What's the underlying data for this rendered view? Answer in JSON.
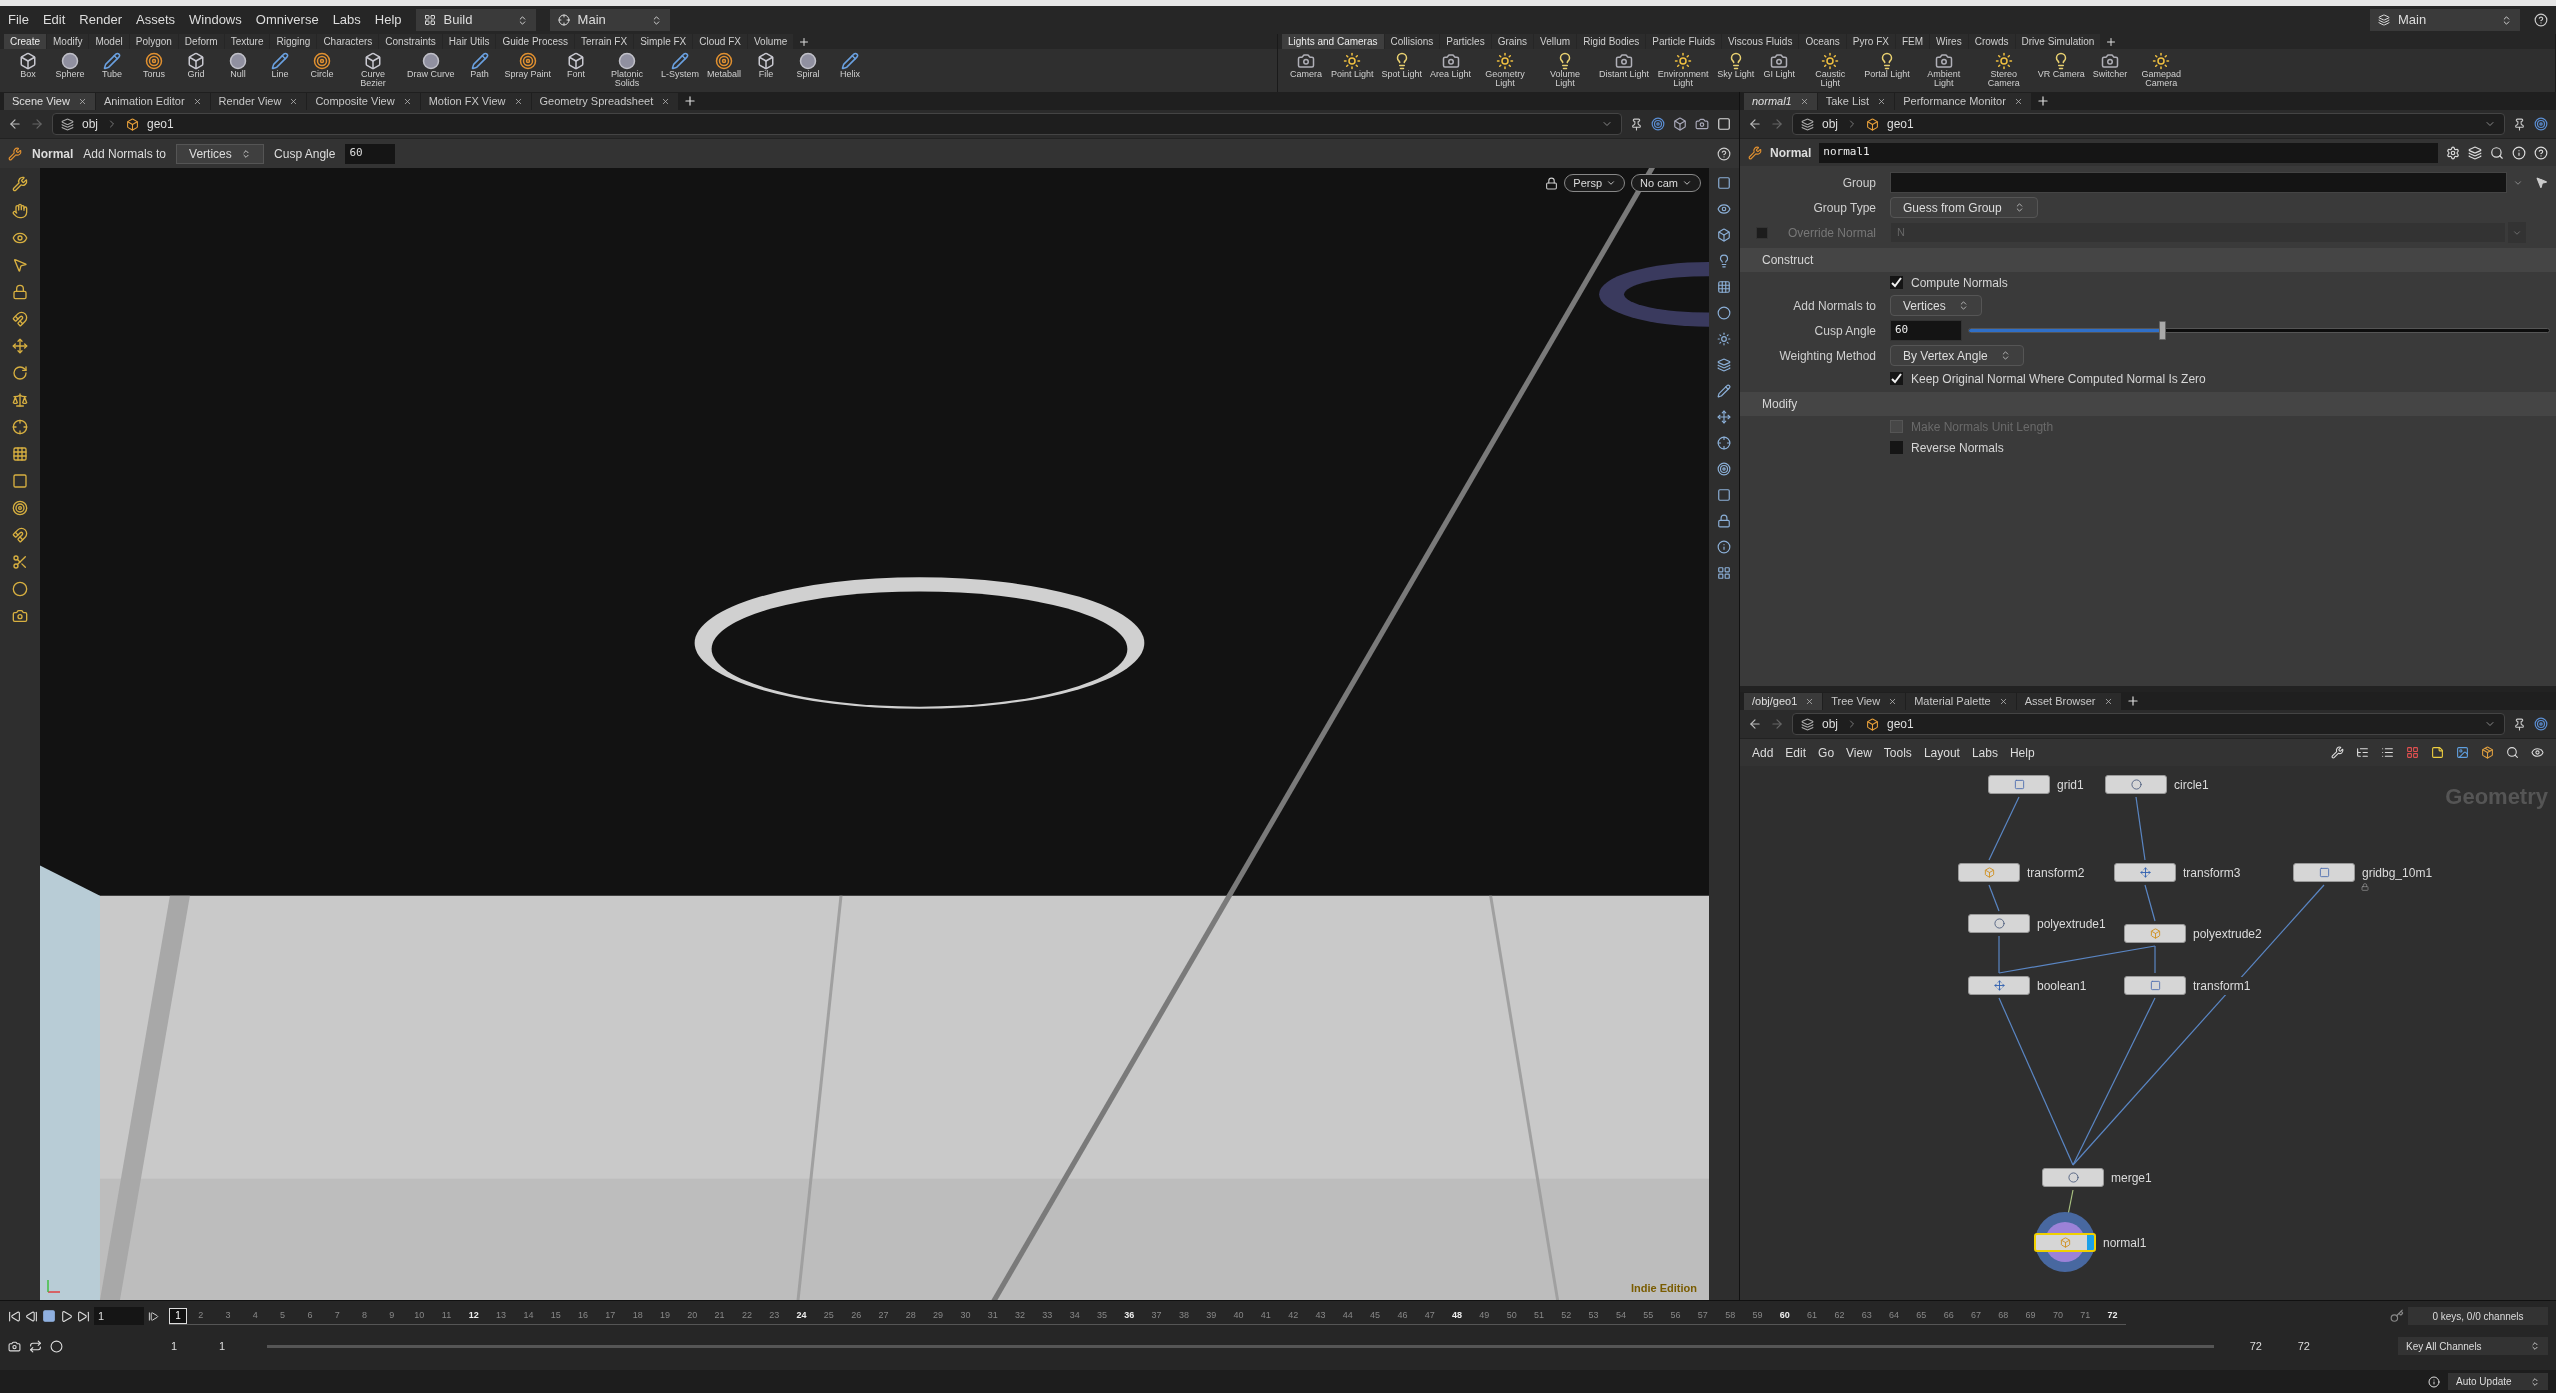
{
  "menu_bar": {
    "items": [
      "File",
      "Edit",
      "Render",
      "Assets",
      "Windows",
      "Omniverse",
      "Labs",
      "Help"
    ],
    "desktop": "Build",
    "workspace": "Main",
    "right_workspace": "Main"
  },
  "shelf_left": {
    "tabs": [
      {
        "label": "Create",
        "selected": true
      },
      {
        "label": "Modify",
        "selected": false
      },
      {
        "label": "Model",
        "selected": false
      },
      {
        "label": "Polygon",
        "selected": false
      },
      {
        "label": "Deform",
        "selected": false
      },
      {
        "label": "Texture",
        "selected": false
      },
      {
        "label": "Rigging",
        "selected": false
      },
      {
        "label": "Characters",
        "selected": false
      },
      {
        "label": "Constraints",
        "selected": false
      },
      {
        "label": "Hair Utils",
        "selected": false
      },
      {
        "label": "Guide Process",
        "selected": false
      },
      {
        "label": "Terrain FX",
        "selected": false
      },
      {
        "label": "Simple FX",
        "selected": false
      },
      {
        "label": "Cloud FX",
        "selected": false
      },
      {
        "label": "Volume",
        "selected": false
      }
    ],
    "tools": [
      "Box",
      "Sphere",
      "Tube",
      "Torus",
      "Grid",
      "Null",
      "Line",
      "Circle",
      "Curve Bezier",
      "Draw Curve",
      "Path",
      "Spray Paint",
      "Font",
      "Platonic Solids",
      "L-System",
      "Metaball",
      "File",
      "Spiral",
      "Helix"
    ]
  },
  "shelf_right": {
    "tabs": [
      {
        "label": "Lights and Cameras",
        "selected": true
      },
      {
        "label": "Collisions",
        "selected": false
      },
      {
        "label": "Particles",
        "selected": false
      },
      {
        "label": "Grains",
        "selected": false
      },
      {
        "label": "Vellum",
        "selected": false
      },
      {
        "label": "Rigid Bodies",
        "selected": false
      },
      {
        "label": "Particle Fluids",
        "selected": false
      },
      {
        "label": "Viscous Fluids",
        "selected": false
      },
      {
        "label": "Oceans",
        "selected": false
      },
      {
        "label": "Pyro FX",
        "selected": false
      },
      {
        "label": "FEM",
        "selected": false
      },
      {
        "label": "Wires",
        "selected": false
      },
      {
        "label": "Crowds",
        "selected": false
      },
      {
        "label": "Drive Simulation",
        "selected": false
      }
    ],
    "tools": [
      "Camera",
      "Point Light",
      "Spot Light",
      "Area Light",
      "Geometry Light",
      "Volume Light",
      "Distant Light",
      "Environment Light",
      "Sky Light",
      "GI Light",
      "Caustic Light",
      "Portal Light",
      "Ambient Light",
      "Stereo Camera",
      "VR Camera",
      "Switcher",
      "Gamepad Camera"
    ]
  },
  "scene_pane": {
    "tabs": [
      {
        "label": "Scene View",
        "selected": true
      },
      {
        "label": "Animation Editor",
        "selected": false
      },
      {
        "label": "Render View",
        "selected": false
      },
      {
        "label": "Composite View",
        "selected": false
      },
      {
        "label": "Motion FX View",
        "selected": false
      },
      {
        "label": "Geometry Spreadsheet",
        "selected": false
      }
    ],
    "path": [
      "obj",
      "geo1"
    ],
    "tool_options": {
      "tool": "Normal",
      "add_label": "Add Normals to",
      "add_value": "Vertices",
      "cusp_label": "Cusp Angle",
      "cusp_value": "60"
    },
    "viewport": {
      "camera_view": "Persp",
      "camera": "No cam",
      "edition": "Indie Edition"
    }
  },
  "param_pane": {
    "tabs": [
      {
        "label": "normal1",
        "selected": true
      },
      {
        "label": "Take List",
        "selected": false
      },
      {
        "label": "Performance Monitor",
        "selected": false
      }
    ],
    "path": [
      "obj",
      "geo1"
    ],
    "node_type": "Normal",
    "node_name": "normal1",
    "params": [
      {
        "kind": "field",
        "label": "Group"
      },
      {
        "kind": "menu",
        "label": "Group Type",
        "value": "Guess from Group"
      },
      {
        "kind": "toggle-field",
        "label": "Override Normal",
        "value": "N",
        "checked": false,
        "disabled": true
      },
      {
        "kind": "section",
        "label": "Construct"
      },
      {
        "kind": "check",
        "label": "Compute Normals",
        "checked": true,
        "disabled": false
      },
      {
        "kind": "menu",
        "label": "Add Normals to",
        "value": "Vertices"
      },
      {
        "kind": "slider",
        "label": "Cusp Angle",
        "value": "60",
        "level": 0.334
      },
      {
        "kind": "menu",
        "label": "Weighting Method",
        "value": "By Vertex Angle"
      },
      {
        "kind": "check",
        "label": "Keep Original Normal Where Computed Normal Is Zero",
        "checked": true,
        "disabled": false
      },
      {
        "kind": "section",
        "label": "Modify"
      },
      {
        "kind": "check",
        "label": "Make Normals Unit Length",
        "checked": false,
        "disabled": true
      },
      {
        "kind": "check",
        "label": "Reverse Normals",
        "checked": false,
        "disabled": false
      }
    ]
  },
  "network_pane": {
    "tabs": [
      {
        "label": "/obj/geo1",
        "selected": true
      },
      {
        "label": "Tree View",
        "selected": false
      },
      {
        "label": "Material Palette",
        "selected": false
      },
      {
        "label": "Asset Browser",
        "selected": false
      }
    ],
    "path": [
      "obj",
      "geo1"
    ],
    "menu": [
      "Add",
      "Edit",
      "Go",
      "View",
      "Tools",
      "Layout",
      "Labs",
      "Help"
    ],
    "context": "Geometry",
    "nodes": [
      {
        "name": "grid1",
        "selected": false,
        "display": false,
        "locked": false
      },
      {
        "name": "circle1",
        "selected": false,
        "display": false,
        "locked": false
      },
      {
        "name": "transform2",
        "selected": false,
        "display": false,
        "locked": false
      },
      {
        "name": "transform3",
        "selected": false,
        "display": false,
        "locked": false
      },
      {
        "name": "gridbg_10m1",
        "selected": false,
        "display": false,
        "locked": true
      },
      {
        "name": "polyextrude1",
        "selected": false,
        "display": false,
        "locked": false
      },
      {
        "name": "polyextrude2",
        "selected": false,
        "display": false,
        "locked": false
      },
      {
        "name": "boolean1",
        "selected": false,
        "display": false,
        "locked": false
      },
      {
        "name": "transform1",
        "selected": false,
        "display": false,
        "locked": false
      },
      {
        "name": "merge1",
        "selected": false,
        "display": false,
        "locked": false
      },
      {
        "name": "normal1",
        "selected": true,
        "display": true,
        "locked": false
      }
    ]
  },
  "timeline": {
    "frame": "1",
    "current": "1",
    "ticks": [
      "2",
      "3",
      "4",
      "5",
      "6",
      "7",
      "8",
      "9",
      "10",
      "11",
      "12",
      "13",
      "14",
      "15",
      "16",
      "17",
      "18",
      "19",
      "20",
      "21",
      "22",
      "23",
      "24",
      "25",
      "26",
      "27",
      "28",
      "29",
      "30",
      "31",
      "32",
      "33",
      "34",
      "35",
      "36",
      "37",
      "38",
      "39",
      "40",
      "41",
      "42",
      "43",
      "44",
      "45",
      "46",
      "47",
      "48",
      "49",
      "50",
      "51",
      "52",
      "53",
      "54",
      "55",
      "56",
      "57",
      "58",
      "59",
      "60",
      "61",
      "62",
      "63",
      "64",
      "65",
      "66",
      "67",
      "68",
      "69",
      "70",
      "71",
      "72"
    ],
    "range_start": "1",
    "playback_start": "1",
    "playback_end": "72",
    "range_end": "72",
    "keys": "0 keys, 0/0 channels",
    "key_button": "Key All Channels"
  },
  "status_bar": {
    "update_mode": "Auto Update"
  }
}
